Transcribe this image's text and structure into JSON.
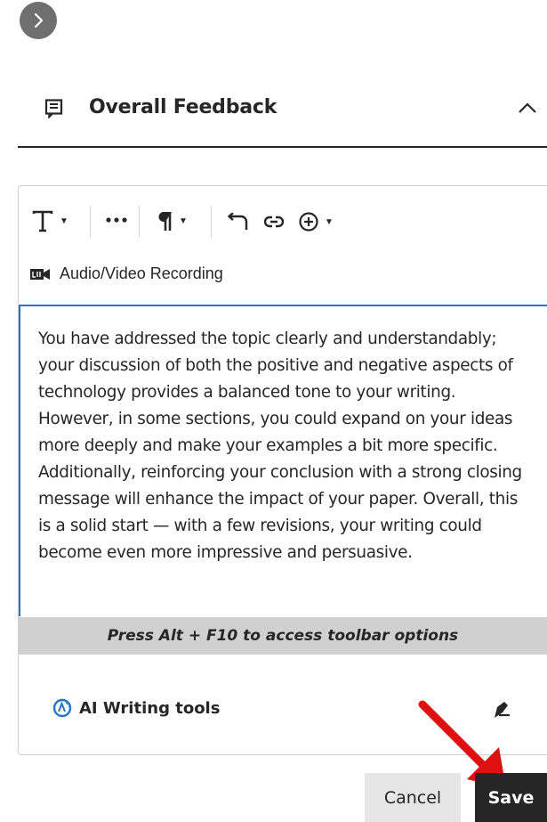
{
  "section": {
    "title": "Overall Feedback"
  },
  "editor": {
    "toolbar": [
      {
        "icon": "text-format-icon",
        "has_dropdown": true
      },
      {
        "icon": "more-options-icon",
        "has_dropdown": false
      },
      {
        "icon": "paragraph-icon",
        "has_dropdown": true
      },
      {
        "icon": "undo-icon",
        "has_dropdown": false
      },
      {
        "icon": "link-icon",
        "has_dropdown": false
      },
      {
        "icon": "insert-content-icon",
        "has_dropdown": true
      }
    ],
    "recording_label": "Audio/Video Recording",
    "content": "You have addressed the topic clearly and understandably; your discussion of both the positive and negative aspects of technology provides a balanced tone to your writing. However, in some sections, you could expand on your ideas more deeply and make your examples a bit more specific. Additionally, reinforcing your conclusion with a strong closing message will enhance the impact of your paper. Overall, this is a solid start — with a few revisions, your writing could become even more impressive and persuasive.",
    "toolbar_hint": "Press Alt + F10 to access toolbar options",
    "ai_tools_label": "AI Writing tools"
  },
  "actions": {
    "cancel_label": "Cancel",
    "save_label": "Save"
  },
  "colors": {
    "focus_border": "#2b72c9",
    "save_bg": "#262626",
    "annotation_arrow": "#e01010",
    "ai_icon": "#2b72c9"
  }
}
